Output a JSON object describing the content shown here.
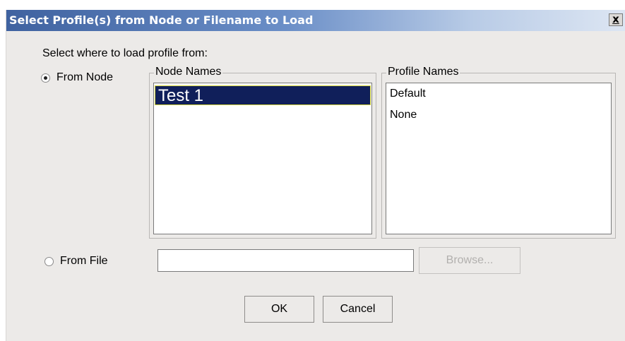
{
  "dialog": {
    "title": "Select Profile(s) from Node or Filename to Load",
    "close_label": "x",
    "prompt": "Select where to load profile from:"
  },
  "from_node": {
    "label": "From Node",
    "selected": true
  },
  "node_names": {
    "label": "Node Names",
    "items": [
      "Test 1"
    ]
  },
  "profile_names": {
    "label": "Profile Names",
    "items": [
      "Default",
      "None"
    ]
  },
  "from_file": {
    "label": "From File",
    "selected": false,
    "value": ""
  },
  "buttons": {
    "browse": "Browse...",
    "ok": "OK",
    "cancel": "Cancel"
  }
}
